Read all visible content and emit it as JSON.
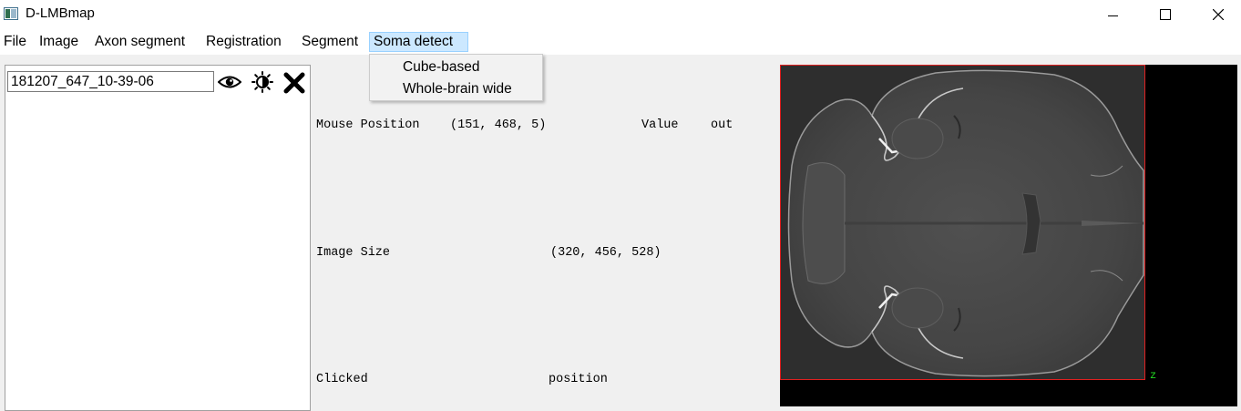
{
  "window": {
    "title": "D-LMBmap",
    "icon": "app-window-icon",
    "controls": {
      "minimize": "minimize-icon",
      "maximize": "maximize-icon",
      "close": "close-icon"
    }
  },
  "menu": {
    "items": [
      "File",
      "Image",
      "Axon segment",
      "Registration",
      "Segment",
      "Soma detect"
    ],
    "active": "Soma detect",
    "dropdown": [
      "Cube-based",
      "Whole-brain wide"
    ],
    "colors": {
      "active_bg": "#cce8ff",
      "active_border": "#99d1ff"
    }
  },
  "layers": {
    "name": "181207_647_10-39-06",
    "icons": [
      "eye-icon",
      "brightness-icon",
      "remove-x-icon"
    ]
  },
  "info": {
    "mouse_position_label": "Mouse Position",
    "mouse_position_value": "(151, 468, 5)",
    "value_label": "Value",
    "value": "out",
    "image_size_label": "Image Size",
    "image_size_value": "(320, 456, 528)",
    "clicked_label": "Clicked",
    "clicked_value": "position"
  },
  "viewer": {
    "axis_label": "z",
    "colors": {
      "frame": "#e02020",
      "axis": "#22dd22",
      "background": "#000000"
    }
  }
}
